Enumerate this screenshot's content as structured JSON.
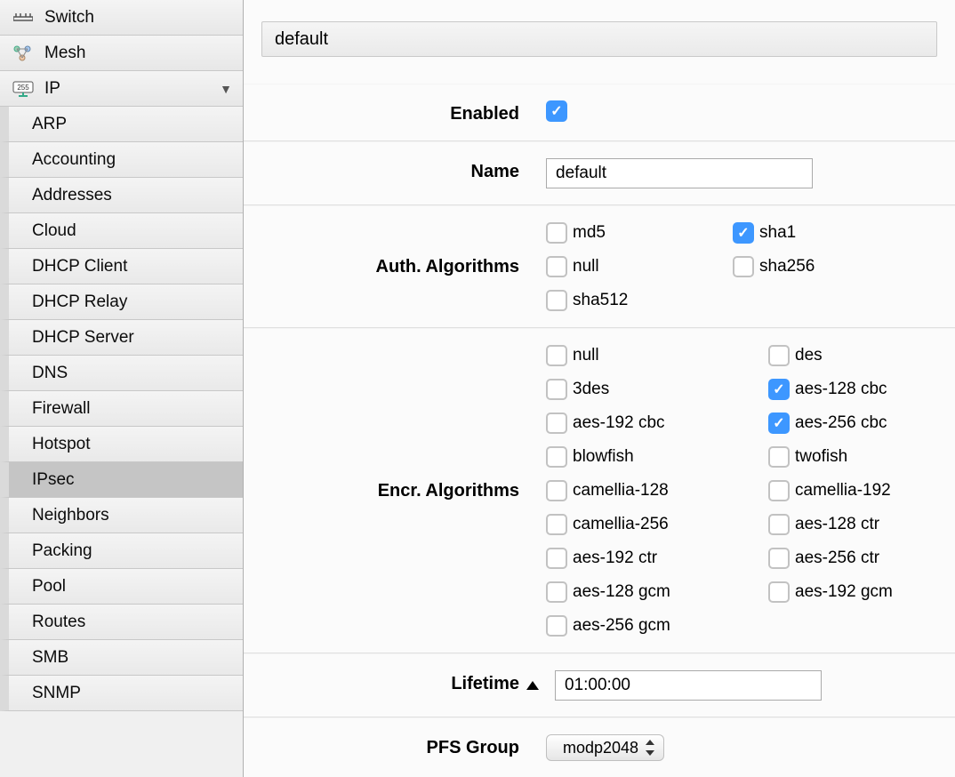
{
  "sidebar": {
    "top_items": [
      {
        "label": "Switch",
        "icon": "switch-icon"
      },
      {
        "label": "Mesh",
        "icon": "mesh-icon"
      },
      {
        "label": "IP",
        "icon": "ip-icon",
        "expanded": true
      }
    ],
    "sub_items": [
      {
        "label": "ARP"
      },
      {
        "label": "Accounting"
      },
      {
        "label": "Addresses"
      },
      {
        "label": "Cloud"
      },
      {
        "label": "DHCP Client"
      },
      {
        "label": "DHCP Relay"
      },
      {
        "label": "DHCP Server"
      },
      {
        "label": "DNS"
      },
      {
        "label": "Firewall"
      },
      {
        "label": "Hotspot"
      },
      {
        "label": "IPsec",
        "active": true
      },
      {
        "label": "Neighbors"
      },
      {
        "label": "Packing"
      },
      {
        "label": "Pool"
      },
      {
        "label": "Routes"
      },
      {
        "label": "SMB"
      },
      {
        "label": "SNMP"
      }
    ]
  },
  "form": {
    "title": "default",
    "rows": {
      "enabled": {
        "label": "Enabled",
        "checked": true
      },
      "name": {
        "label": "Name",
        "value": "default"
      },
      "auth": {
        "label": "Auth. Algorithms"
      },
      "encr": {
        "label": "Encr. Algorithms"
      },
      "lifetime": {
        "label": "Lifetime",
        "value": "01:00:00"
      },
      "pfs": {
        "label": "PFS Group",
        "value": "modp2048"
      }
    },
    "auth_algorithms": [
      {
        "label": "md5",
        "checked": false
      },
      {
        "label": "sha1",
        "checked": true
      },
      {
        "label": "null",
        "checked": false
      },
      {
        "label": "sha256",
        "checked": false
      },
      {
        "label": "sha512",
        "checked": false
      }
    ],
    "encr_algorithms": [
      {
        "label": "null",
        "checked": false
      },
      {
        "label": "des",
        "checked": false
      },
      {
        "label": "3des",
        "checked": false
      },
      {
        "label": "aes-128 cbc",
        "checked": true
      },
      {
        "label": "aes-192 cbc",
        "checked": false
      },
      {
        "label": "aes-256 cbc",
        "checked": true
      },
      {
        "label": "blowfish",
        "checked": false
      },
      {
        "label": "twofish",
        "checked": false
      },
      {
        "label": "camellia-128",
        "checked": false
      },
      {
        "label": "camellia-192",
        "checked": false
      },
      {
        "label": "camellia-256",
        "checked": false
      },
      {
        "label": "aes-128 ctr",
        "checked": false
      },
      {
        "label": "aes-192 ctr",
        "checked": false
      },
      {
        "label": "aes-256 ctr",
        "checked": false
      },
      {
        "label": "aes-128 gcm",
        "checked": false
      },
      {
        "label": "aes-192 gcm",
        "checked": false
      },
      {
        "label": "aes-256 gcm",
        "checked": false
      }
    ]
  }
}
